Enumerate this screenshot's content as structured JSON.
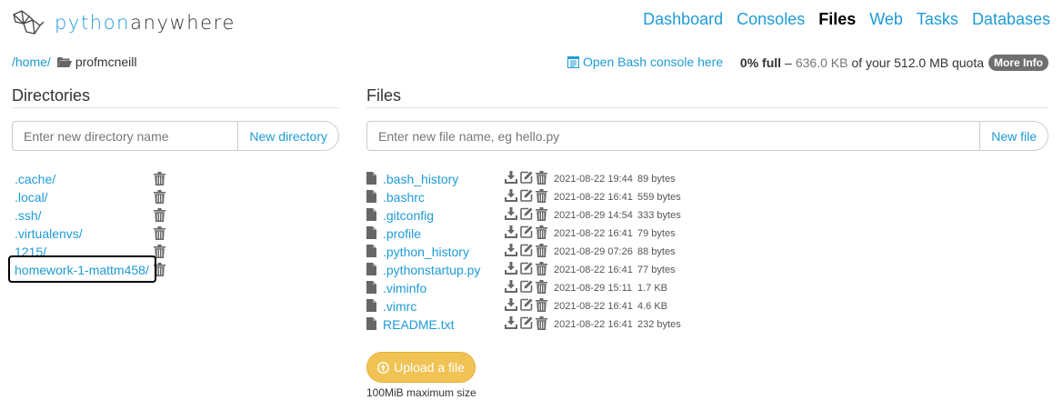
{
  "brand": {
    "part1": "python",
    "part2": "anywhere"
  },
  "nav": [
    {
      "label": "Dashboard",
      "active": false
    },
    {
      "label": "Consoles",
      "active": false
    },
    {
      "label": "Files",
      "active": true
    },
    {
      "label": "Web",
      "active": false
    },
    {
      "label": "Tasks",
      "active": false
    },
    {
      "label": "Databases",
      "active": false
    }
  ],
  "breadcrumb": {
    "home": "/home/",
    "current": "profmcneill"
  },
  "bash_link": "Open Bash console here",
  "quota": {
    "full": "0% full",
    "dash": "–",
    "used": "636.0 KB",
    "of": "of your 512.0 MB quota",
    "more": "More Info"
  },
  "directories": {
    "title": "Directories",
    "placeholder": "Enter new directory name",
    "button": "New directory",
    "items": [
      ".cache/",
      ".local/",
      ".ssh/",
      ".virtualenvs/",
      "1215/",
      "homework-1-mattm458/"
    ]
  },
  "files": {
    "title": "Files",
    "placeholder": "Enter new file name, eg hello.py",
    "button": "New file",
    "items": [
      {
        "name": ".bash_history",
        "date": "2021-08-22 19:44",
        "size": "89 bytes"
      },
      {
        "name": ".bashrc",
        "date": "2021-08-22 16:41",
        "size": "559 bytes"
      },
      {
        "name": ".gitconfig",
        "date": "2021-08-29 14:54",
        "size": "333 bytes"
      },
      {
        "name": ".profile",
        "date": "2021-08-22 16:41",
        "size": "79 bytes"
      },
      {
        "name": ".python_history",
        "date": "2021-08-29 07:26",
        "size": "88 bytes"
      },
      {
        "name": ".pythonstartup.py",
        "date": "2021-08-22 16:41",
        "size": "77 bytes"
      },
      {
        "name": ".viminfo",
        "date": "2021-08-29 15:11",
        "size": "1.7 KB"
      },
      {
        "name": ".vimrc",
        "date": "2021-08-22 16:41",
        "size": "4.6 KB"
      },
      {
        "name": "README.txt",
        "date": "2021-08-22 16:41",
        "size": "232 bytes"
      }
    ]
  },
  "upload": {
    "label": "Upload a file",
    "note": "100MiB maximum size"
  },
  "colors": {
    "link": "#1e9bd7",
    "upload": "#f0c354",
    "badge": "#6f6f6f"
  }
}
